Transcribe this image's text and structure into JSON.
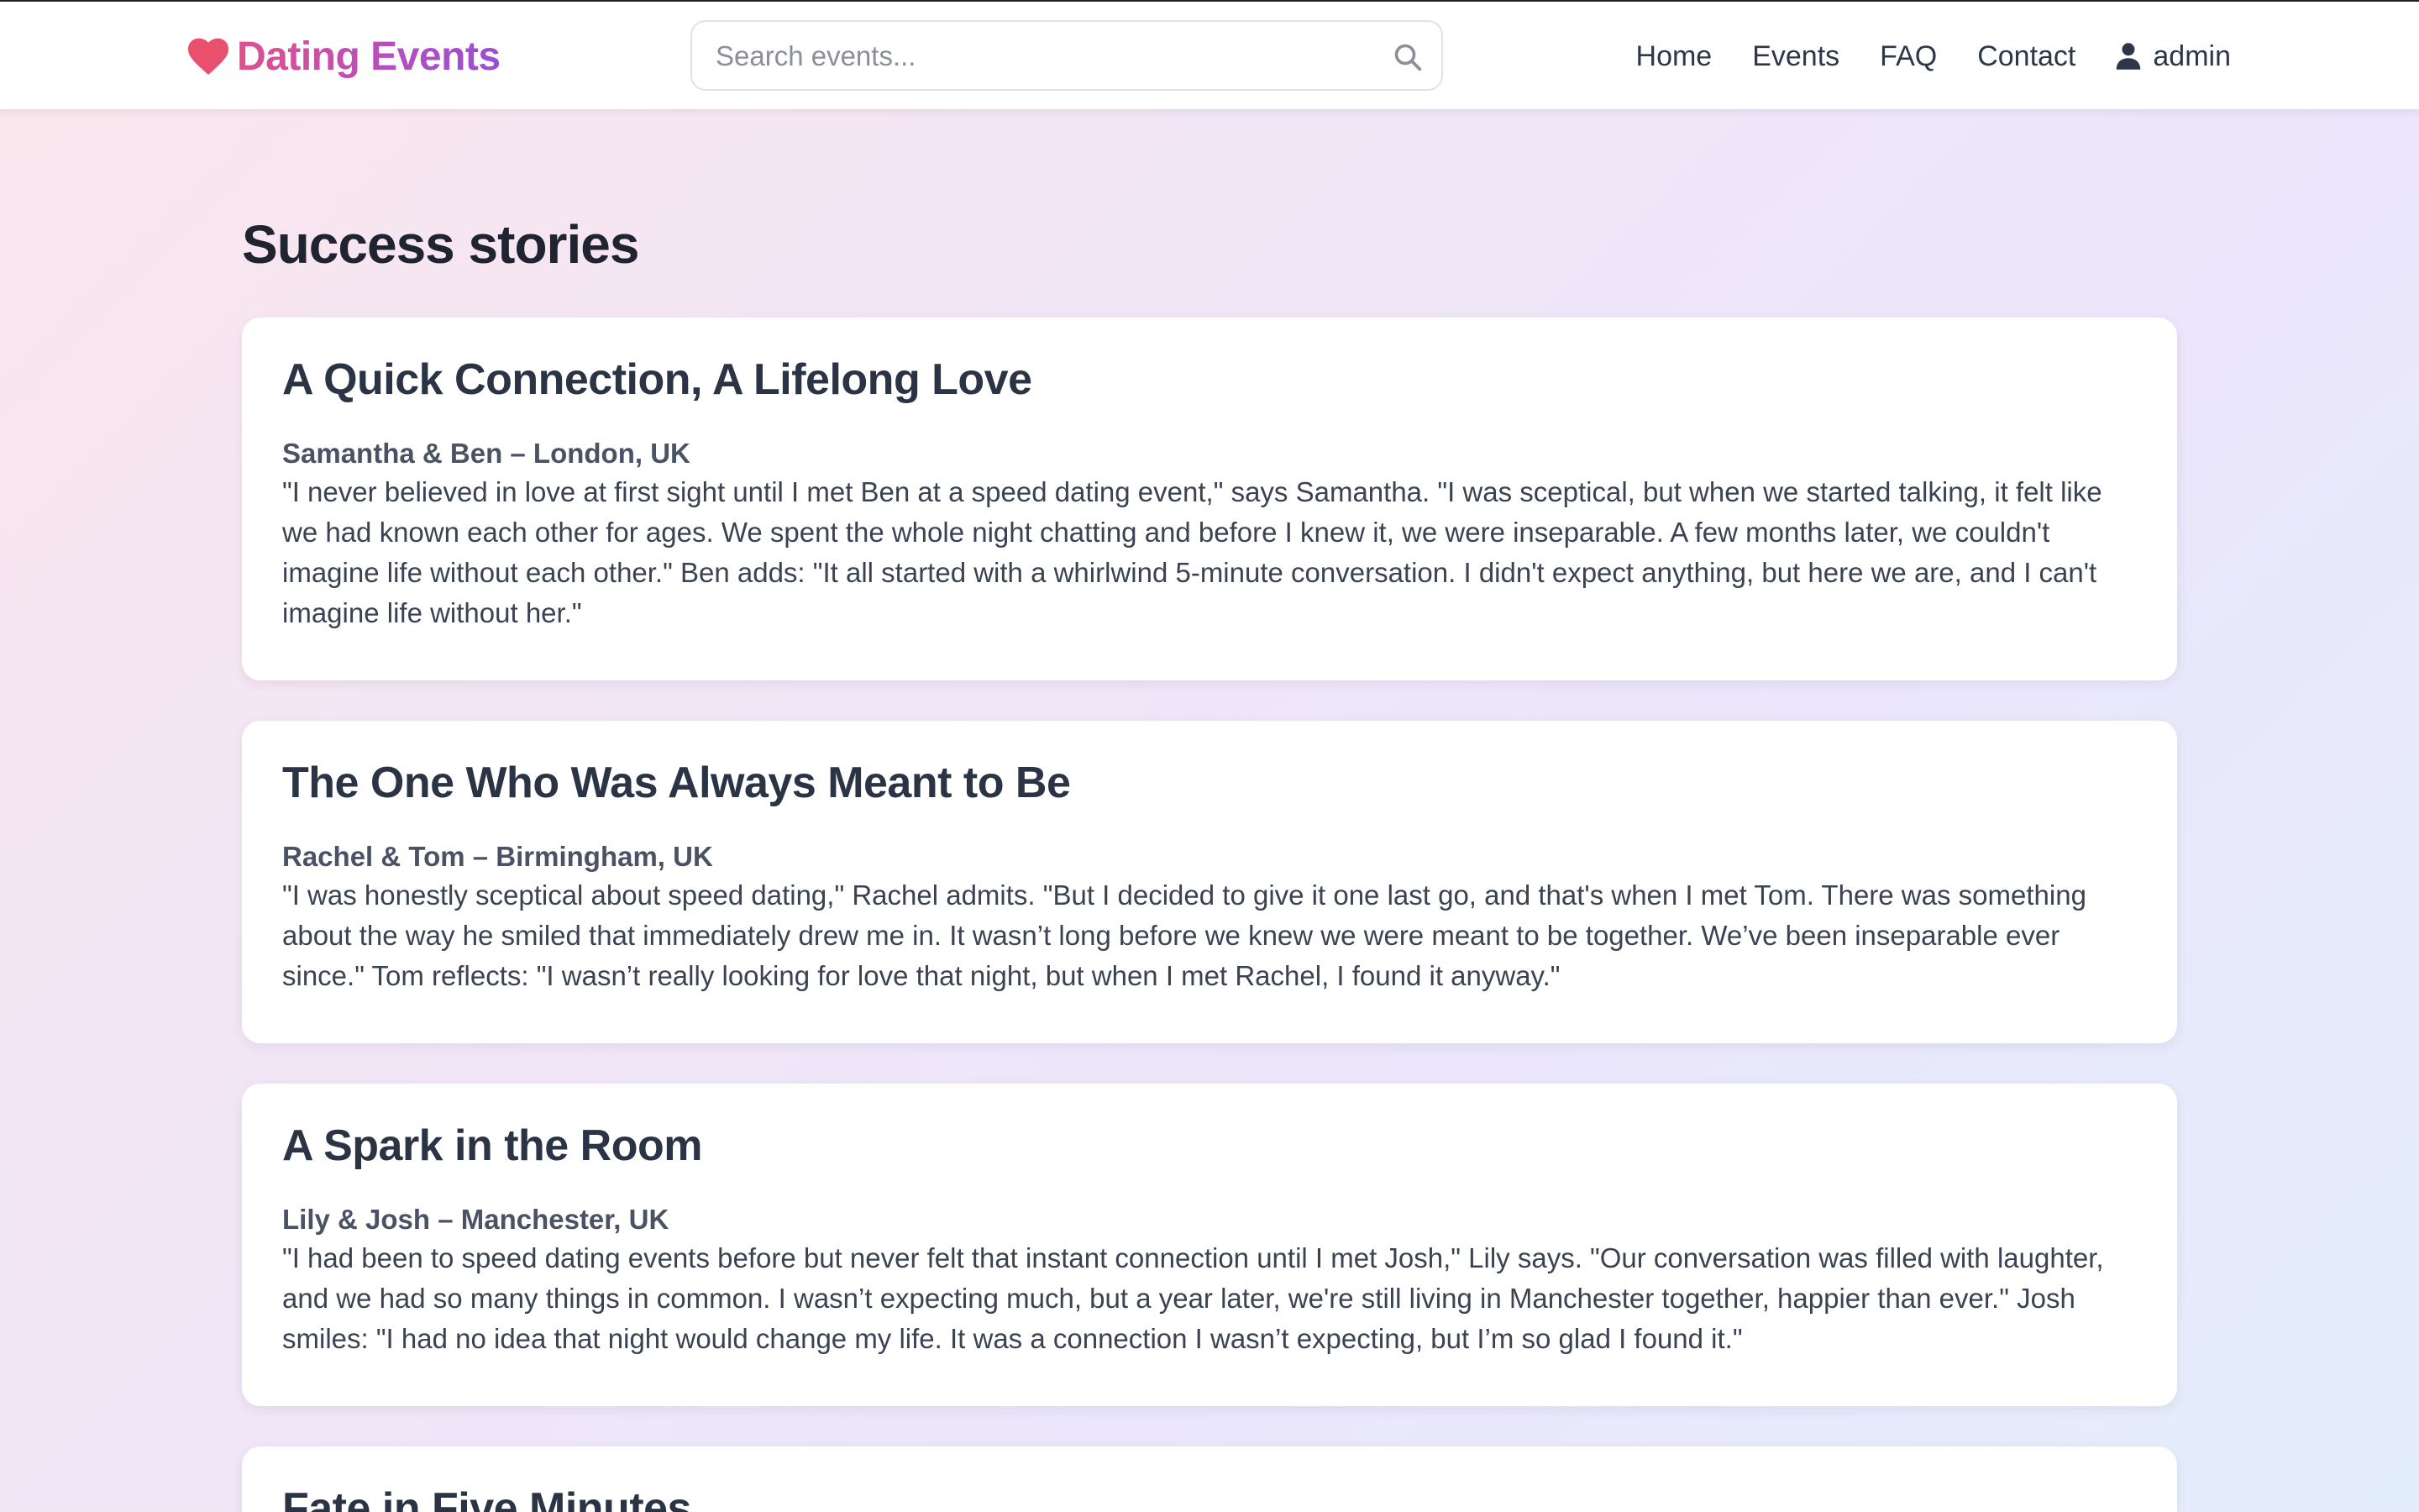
{
  "header": {
    "brand": "Dating Events",
    "search_placeholder": "Search events...",
    "nav": [
      "Home",
      "Events",
      "FAQ",
      "Contact"
    ],
    "user": "admin"
  },
  "page": {
    "title": "Success stories"
  },
  "stories": [
    {
      "title": "A Quick Connection, A Lifelong Love",
      "meta": "Samantha & Ben – London, UK",
      "text": "\"I never believed in love at first sight until I met Ben at a speed dating event,\" says Samantha. \"I was sceptical, but when we started talking, it felt like we had known each other for ages. We spent the whole night chatting and before I knew it, we were inseparable. A few months later, we couldn't imagine life without each other.\" Ben adds: \"It all started with a whirlwind 5-minute conversation. I didn't expect anything, but here we are, and I can't imagine life without her.\""
    },
    {
      "title": "The One Who Was Always Meant to Be",
      "meta": "Rachel & Tom – Birmingham, UK",
      "text": "\"I was honestly sceptical about speed dating,\" Rachel admits. \"But I decided to give it one last go, and that's when I met Tom. There was something about the way he smiled that immediately drew me in. It wasn’t long before we knew we were meant to be together. We’ve been inseparable ever since.\" Tom reflects: \"I wasn’t really looking for love that night, but when I met Rachel, I found it anyway.\""
    },
    {
      "title": "A Spark in the Room",
      "meta": "Lily & Josh – Manchester, UK",
      "text": "\"I had been to speed dating events before but never felt that instant connection until I met Josh,\" Lily says. \"Our conversation was filled with laughter, and we had so many things in common. I wasn’t expecting much, but a year later, we're still living in Manchester together, happier than ever.\" Josh smiles: \"I had no idea that night would change my life. It was a connection I wasn’t expecting, but I’m so glad I found it.\""
    },
    {
      "title": "Fate in Five Minutes"
    }
  ],
  "colors": {
    "brand_pink": "#e0508a",
    "brand_purple": "#9a4fd0",
    "heart": "#e8506e"
  }
}
